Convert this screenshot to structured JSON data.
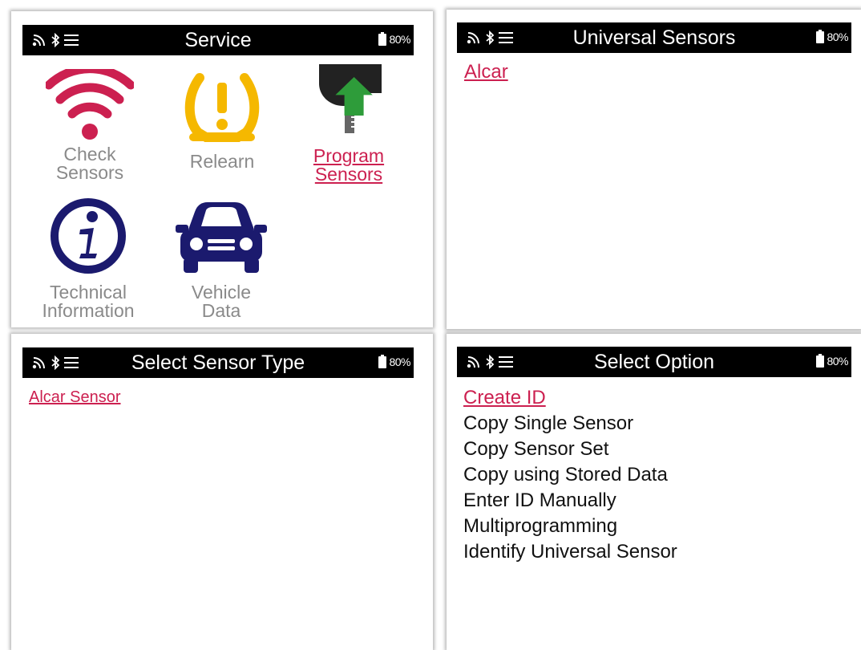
{
  "screens": {
    "service": {
      "title": "Service",
      "battery": "80%",
      "tiles": [
        {
          "label": "Check\nSensors",
          "icon": "wifi-signal-icon"
        },
        {
          "label": "Relearn",
          "icon": "tire-pressure-warning-icon"
        },
        {
          "label": "Program\nSensors",
          "icon": "sensor-program-upload-icon"
        },
        {
          "label": "Technical\nInformation",
          "icon": "info-icon"
        },
        {
          "label": "Vehicle\nData",
          "icon": "car-icon"
        }
      ],
      "selected": "Program Sensors"
    },
    "universal_sensors": {
      "title": "Universal Sensors",
      "battery": "80%",
      "items": [
        "Alcar"
      ]
    },
    "select_sensor_type": {
      "title": "Select Sensor Type",
      "battery": "80%",
      "items": [
        "Alcar Sensor"
      ]
    },
    "select_option": {
      "title": "Select Option",
      "battery": "80%",
      "items": [
        "Create ID",
        "Copy Single Sensor",
        "Copy Sensor Set",
        "Copy using Stored Data",
        "Enter ID Manually",
        "Multiprogramming",
        "Identify Universal Sensor"
      ],
      "selected_index": 0
    }
  },
  "colors": {
    "accent_red": "#cc2050",
    "warning_yellow": "#f5b800",
    "navy": "#1b1a6e",
    "upload_green": "#2e9c3a",
    "inactive_gray": "#8a8a8a"
  },
  "status_icons": [
    "wireless-icon",
    "bluetooth-icon",
    "menu-icon",
    "battery-icon"
  ]
}
